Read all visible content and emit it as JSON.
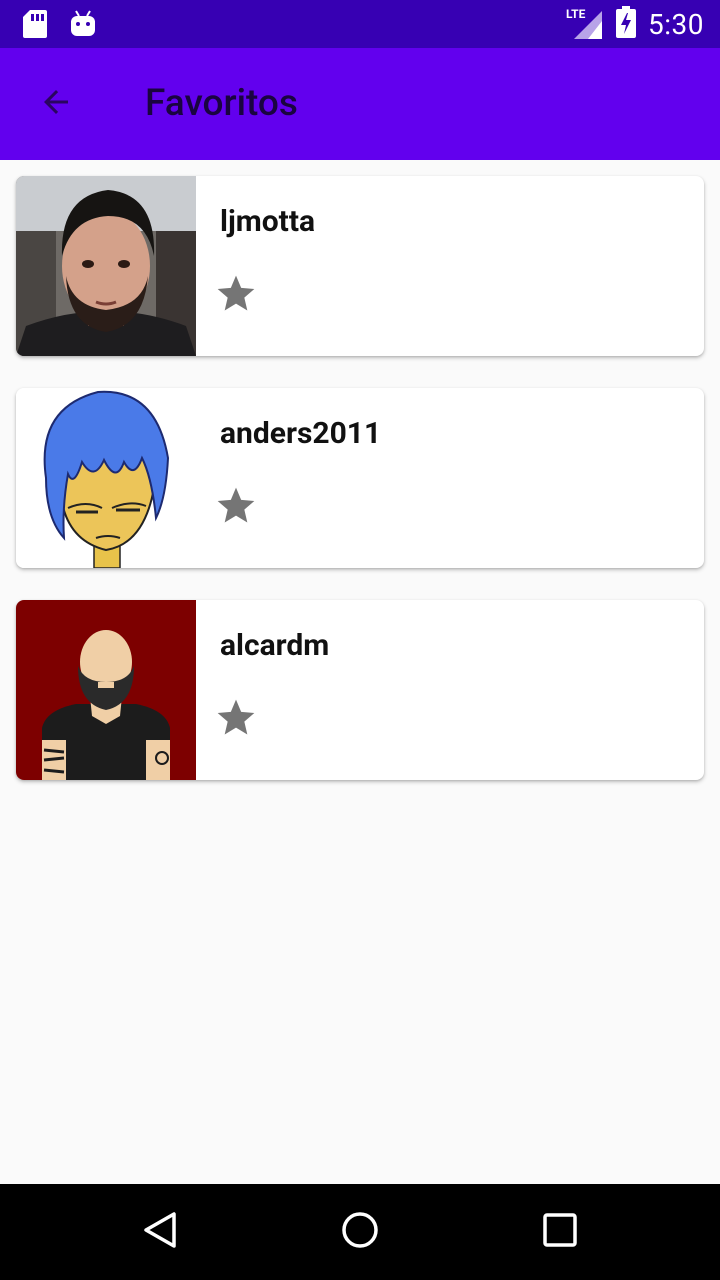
{
  "status_bar": {
    "time": "5:30",
    "network": "LTE",
    "icons": [
      "sd-card-icon",
      "android-icon",
      "signal-icon",
      "battery-charging-icon"
    ]
  },
  "app_bar": {
    "title": "Favoritos",
    "back_icon": "arrow-back-icon"
  },
  "favorites": [
    {
      "username": "ljmotta",
      "favorite_icon": "star-icon"
    },
    {
      "username": "anders2011",
      "favorite_icon": "star-icon"
    },
    {
      "username": "alcardm",
      "favorite_icon": "star-icon"
    }
  ],
  "nav_bar": {
    "buttons": [
      "back-triangle-icon",
      "home-circle-icon",
      "recents-square-icon"
    ]
  },
  "colors": {
    "status_bar": "#3700b3",
    "app_bar": "#6200ee",
    "background": "#fafafa",
    "star": "#757575"
  }
}
